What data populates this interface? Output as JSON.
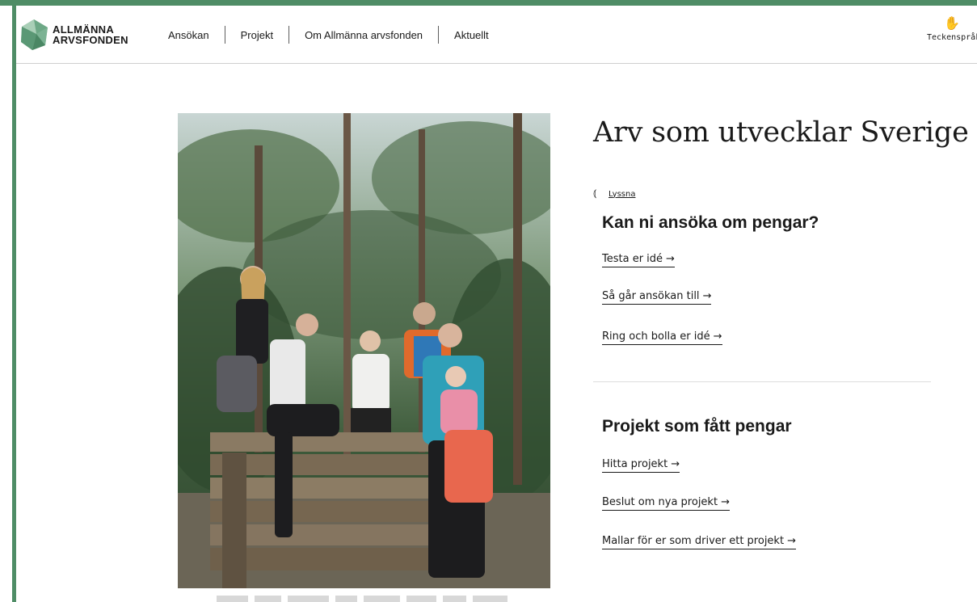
{
  "logo": {
    "line1": "ALLMÄNNA",
    "line2": "ARVSFONDEN"
  },
  "nav": {
    "items": [
      {
        "label": "Ansökan"
      },
      {
        "label": "Projekt"
      },
      {
        "label": "Om Allmänna arvsfonden"
      },
      {
        "label": "Aktuellt"
      }
    ]
  },
  "sign_language": {
    "label": "Teckenspråk",
    "icon": "hand-sign-icon"
  },
  "hero": {
    "headline": "Arv som utvecklar Sverige",
    "image_icon": "family-photo"
  },
  "listen": {
    "label": "Lyssna",
    "icon": "ear-icon"
  },
  "apply_section": {
    "title": "Kan ni ansöka om pengar?",
    "links": [
      {
        "label": "Testa er idé"
      },
      {
        "label": "Så går ansökan till"
      },
      {
        "label": "Ring och bolla er idé"
      }
    ]
  },
  "projects_section": {
    "title": "Projekt som fått pengar",
    "links": [
      {
        "label": "Hitta projekt"
      },
      {
        "label": "Beslut om nya projekt"
      },
      {
        "label": "Mallar för er som driver ett projekt"
      }
    ]
  },
  "arrow": "→",
  "colors": {
    "frame": "#4f8d66",
    "text": "#1a1a1a"
  }
}
